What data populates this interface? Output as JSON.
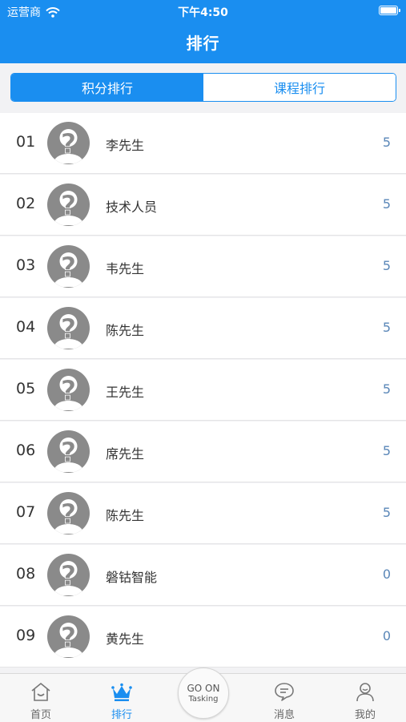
{
  "status": {
    "carrier": "运营商",
    "time": "下午4:50"
  },
  "header": {
    "title": "排行"
  },
  "segments": [
    {
      "label": "积分排行",
      "active": true
    },
    {
      "label": "课程排行",
      "active": false
    }
  ],
  "rankings": [
    {
      "rank": "01",
      "name": "李先生",
      "score": "5"
    },
    {
      "rank": "02",
      "name": "技术人员",
      "score": "5"
    },
    {
      "rank": "03",
      "name": "韦先生",
      "score": "5"
    },
    {
      "rank": "04",
      "name": "陈先生",
      "score": "5"
    },
    {
      "rank": "05",
      "name": "王先生",
      "score": "5"
    },
    {
      "rank": "06",
      "name": "席先生",
      "score": "5"
    },
    {
      "rank": "07",
      "name": "陈先生",
      "score": "5"
    },
    {
      "rank": "08",
      "name": "磐钴智能",
      "score": "0"
    },
    {
      "rank": "09",
      "name": "黄先生",
      "score": "0"
    }
  ],
  "tabbar": {
    "items": [
      {
        "label": "首页",
        "icon": "home-icon",
        "active": false
      },
      {
        "label": "排行",
        "icon": "crown-icon",
        "active": true
      },
      {
        "label": "消息",
        "icon": "message-icon",
        "active": false
      },
      {
        "label": "我的",
        "icon": "user-icon",
        "active": false
      }
    ],
    "center_button": {
      "line1": "GO ON",
      "line2": "Tasking"
    }
  },
  "colors": {
    "accent": "#1a8ef0",
    "score": "#5a87b8"
  }
}
